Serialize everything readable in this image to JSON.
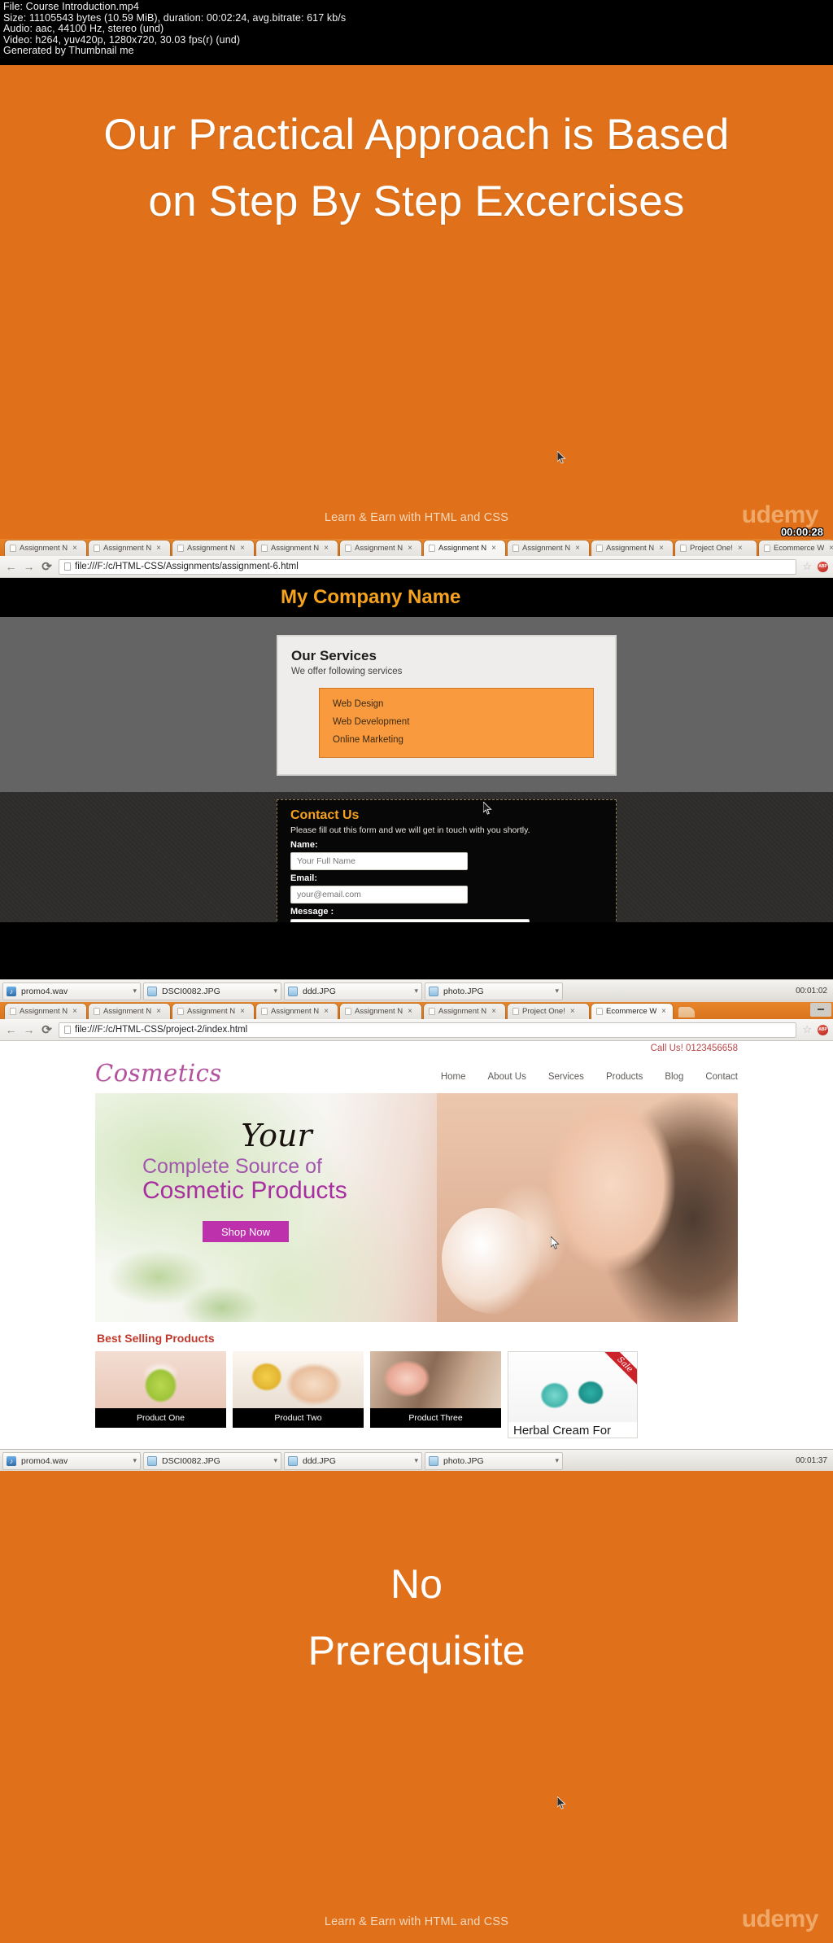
{
  "meta_header": {
    "lines": [
      "File: Course Introduction.mp4",
      "Size: 11105543 bytes (10.59 MiB), duration: 00:02:24, avg.bitrate: 617 kb/s",
      "Audio: aac, 44100 Hz, stereo (und)",
      "Video: h264, yuv420p, 1280x720, 30.03 fps(r) (und)",
      "Generated by Thumbnail me"
    ]
  },
  "slide1": {
    "title_line1": "Our Practical Approach is Based",
    "title_line2": "on Step By Step Excercises",
    "footer": "Learn & Earn with HTML and CSS",
    "brand": "udemy",
    "timestamp": "00:00:28",
    "bg_color": "#e0711a"
  },
  "browser1": {
    "tabs": [
      {
        "label": "Assignment N",
        "active": false
      },
      {
        "label": "Assignment N",
        "active": false
      },
      {
        "label": "Assignment N",
        "active": false
      },
      {
        "label": "Assignment N",
        "active": false
      },
      {
        "label": "Assignment N",
        "active": false
      },
      {
        "label": "Assignment N",
        "active": true
      },
      {
        "label": "Assignment N",
        "active": false
      },
      {
        "label": "Assignment N",
        "active": false
      },
      {
        "label": "Project One!",
        "active": false
      },
      {
        "label": "Ecommerce W",
        "active": false
      }
    ],
    "close_glyph": "×",
    "back_glyph": "←",
    "forward_glyph": "→",
    "reload_glyph": "⟳",
    "star_glyph": "☆",
    "url": "file:///F:/c/HTML-CSS/Assignments/assignment-6.html"
  },
  "company_page": {
    "site_title": "My Company Name",
    "services": {
      "heading": "Our Services",
      "subheading": "We offer following services",
      "items": [
        "Web Design",
        "Web Development",
        "Online Marketing"
      ]
    },
    "contact": {
      "heading": "Contact Us",
      "intro": "Please fill out this form and we will get in touch with you shortly.",
      "name_label": "Name:",
      "name_placeholder": "Your Full Name",
      "name_value": "",
      "email_label": "Email:",
      "email_placeholder": "your@email.com",
      "email_value": "",
      "message_label": "Message :",
      "message_placeholder": "",
      "message_value": ""
    }
  },
  "taskbar1": {
    "items": [
      {
        "label": "promo4.wav",
        "icon": "audio-file-icon"
      },
      {
        "label": "DSCI0082.JPG",
        "icon": "image-file-icon"
      },
      {
        "label": "ddd.JPG",
        "icon": "image-file-icon"
      },
      {
        "label": "photo.JPG",
        "icon": "image-file-icon"
      }
    ],
    "caret": "▾",
    "timestamp": "00:01:02"
  },
  "browser2": {
    "tabs": [
      {
        "label": "Assignment N",
        "active": false
      },
      {
        "label": "Assignment N",
        "active": false
      },
      {
        "label": "Assignment N",
        "active": false
      },
      {
        "label": "Assignment N",
        "active": false
      },
      {
        "label": "Assignment N",
        "active": false
      },
      {
        "label": "Assignment N",
        "active": false
      },
      {
        "label": "Project One!",
        "active": false
      },
      {
        "label": "Ecommerce W",
        "active": true
      }
    ],
    "url": "file:///F:/c/HTML-CSS/project-2/index.html"
  },
  "cosmetics_page": {
    "logo": "Cosmetics",
    "call_us": "Call Us! 0123456658",
    "nav": [
      "Home",
      "About Us",
      "Services",
      "Products",
      "Blog",
      "Contact"
    ],
    "hero": {
      "script_word": "Your",
      "line1": "Complete Source of",
      "line2": "Cosmetic Products",
      "cta": "Shop Now"
    },
    "best_selling_title": "Best Selling Products",
    "products": [
      {
        "name": "Product One",
        "badge": ""
      },
      {
        "name": "Product Two",
        "badge": ""
      },
      {
        "name": "Product Three",
        "badge": ""
      },
      {
        "name": "Herbal Cream For",
        "badge": "Sale"
      }
    ]
  },
  "taskbar2": {
    "items": [
      {
        "label": "promo4.wav",
        "icon": "audio-file-icon"
      },
      {
        "label": "DSCI0082.JPG",
        "icon": "image-file-icon"
      },
      {
        "label": "ddd.JPG",
        "icon": "image-file-icon"
      },
      {
        "label": "photo.JPG",
        "icon": "image-file-icon"
      }
    ],
    "timestamp": "00:01:37"
  },
  "slide2": {
    "title_line1": "No",
    "title_line2": "Prerequisite",
    "footer": "Learn & Earn with HTML and CSS",
    "brand": "udemy",
    "bg_color": "#e0711a"
  }
}
